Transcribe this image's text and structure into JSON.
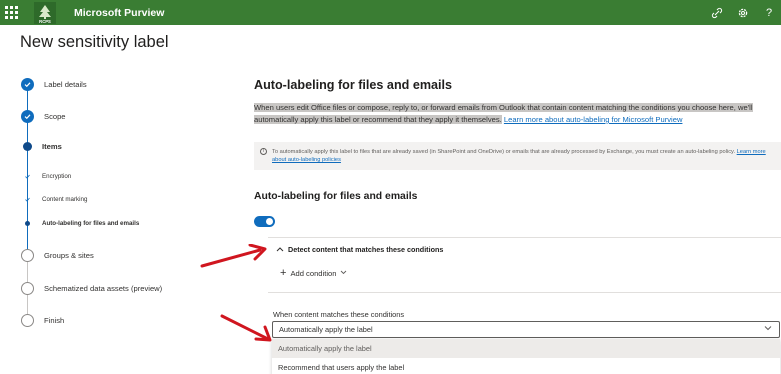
{
  "app": {
    "title": "Microsoft Purview",
    "logo_text": "RCPS",
    "brand_color": "#3a7d33",
    "top_icons": [
      "link-icon",
      "settings-icon",
      "help-icon"
    ],
    "help_glyph": "?"
  },
  "page": {
    "title": "New sensitivity label"
  },
  "stepper": {
    "steps": [
      {
        "label": "Label details",
        "state": "done"
      },
      {
        "label": "Scope",
        "state": "done"
      },
      {
        "label": "Items",
        "state": "current"
      },
      {
        "label": "Encryption",
        "state": "sub-done"
      },
      {
        "label": "Content marking",
        "state": "sub-done"
      },
      {
        "label": "Auto-labeling for files and emails",
        "state": "sub-current"
      },
      {
        "label": "Groups & sites",
        "state": "todo"
      },
      {
        "label": "Schematized data assets (preview)",
        "state": "todo"
      },
      {
        "label": "Finish",
        "state": "todo"
      }
    ]
  },
  "main": {
    "heading": "Auto-labeling for files and emails",
    "description": "When users edit Office files or compose, reply to, or forward emails from Outlook that contain content matching the conditions you choose here, we'll automatically apply this label or recommend that they apply it themselves.",
    "learn_more": "Learn more about auto-labeling for Microsoft Purview",
    "info_text": "To automatically apply this label to files that are already saved (in SharePoint and OneDrive) or emails that are already processed by Exchange, you must create an auto-labeling policy.",
    "info_link": "Learn more about auto-labeling policies",
    "info_glyph": "i",
    "subheading": "Auto-labeling for files and emails",
    "toggle_on": true,
    "accent": "#0f6cbd",
    "detect_label": "Detect content that matches these conditions",
    "add_condition": "Add condition",
    "when_label": "When content matches these conditions",
    "select_value": "Automatically apply the label",
    "options": [
      "Automatically apply the label",
      "Recommend that users apply the label"
    ]
  },
  "annotations": {
    "arrow_color": "#d0161f"
  }
}
